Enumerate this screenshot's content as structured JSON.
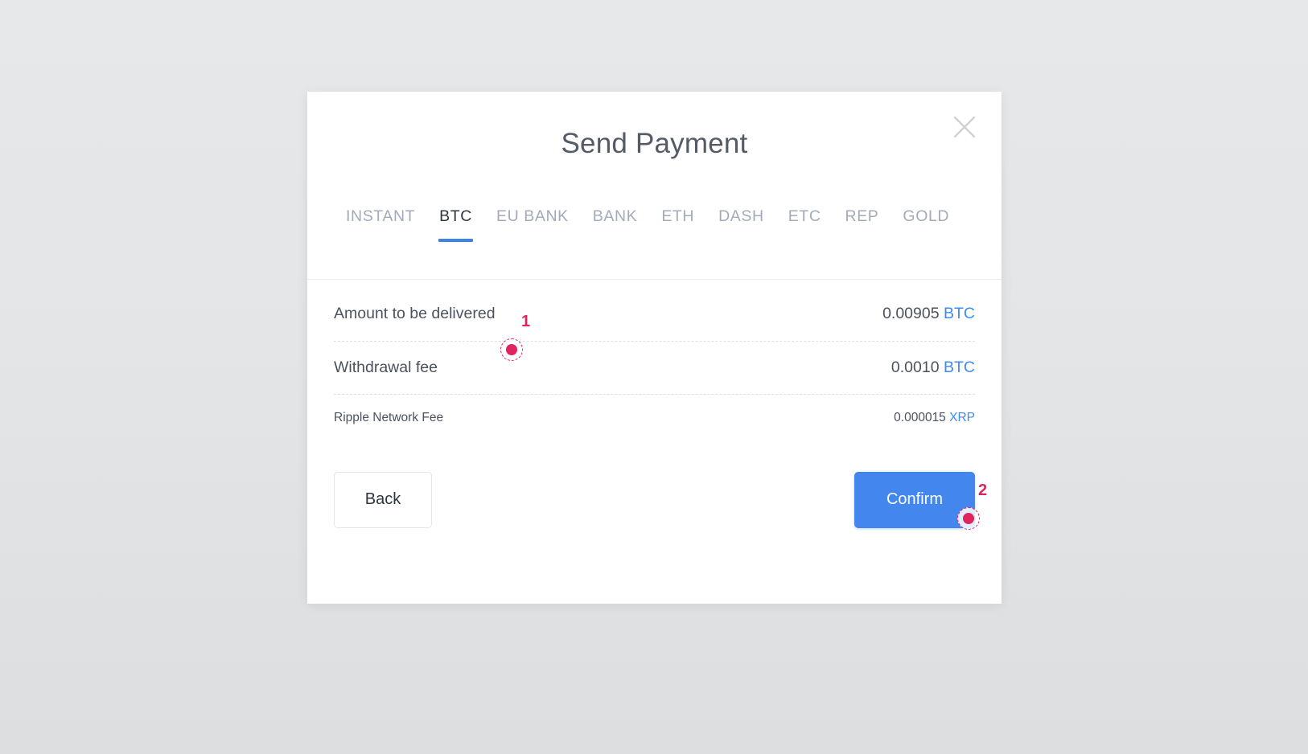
{
  "dialog": {
    "title": "Send Payment",
    "close_icon": "close-icon"
  },
  "tabs": [
    {
      "label": "INSTANT",
      "active": false
    },
    {
      "label": "BTC",
      "active": true
    },
    {
      "label": "EU BANK",
      "active": false
    },
    {
      "label": "BANK",
      "active": false
    },
    {
      "label": "ETH",
      "active": false
    },
    {
      "label": "DASH",
      "active": false
    },
    {
      "label": "ETC",
      "active": false
    },
    {
      "label": "REP",
      "active": false
    },
    {
      "label": "GOLD",
      "active": false
    }
  ],
  "rows": [
    {
      "label": "Amount to be delivered",
      "amount": "0.00905",
      "currency": "BTC",
      "size": "normal"
    },
    {
      "label": "Withdrawal fee",
      "amount": "0.0010",
      "currency": "BTC",
      "size": "normal"
    },
    {
      "label": "Ripple Network Fee",
      "amount": "0.000015",
      "currency": "XRP",
      "size": "small"
    }
  ],
  "footer": {
    "back_label": "Back",
    "confirm_label": "Confirm"
  },
  "annotations": [
    {
      "number": "1",
      "target": "amount-to-be-delivered-row"
    },
    {
      "number": "2",
      "target": "confirm-button"
    }
  ],
  "colors": {
    "accent_blue": "#4286ee",
    "tab_underline": "#3d82e8",
    "currency_blue": "#3d8bf2",
    "marker": "#e0245e",
    "page_background": "#e4e6e8",
    "dialog_background": "#ffffff",
    "title_text": "#545b67",
    "tab_inactive": "#a3aab9",
    "tab_active": "#2f3640"
  }
}
